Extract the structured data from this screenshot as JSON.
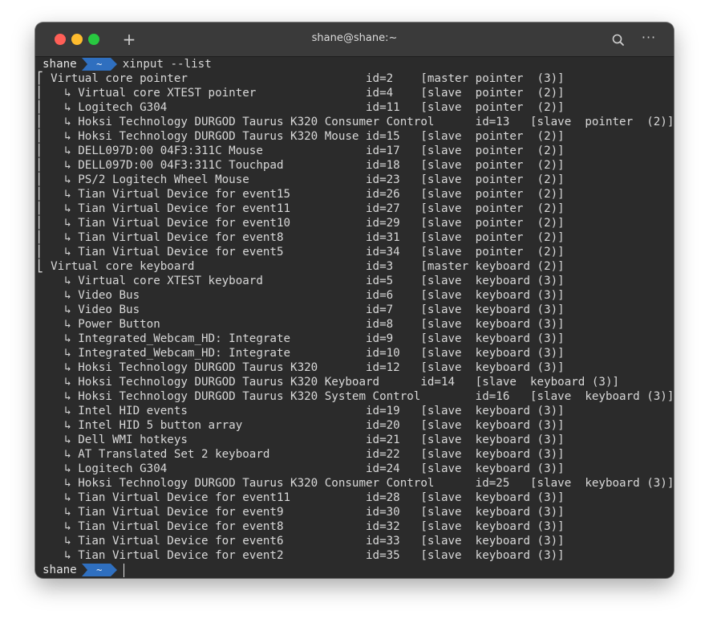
{
  "window": {
    "title": "shane@shane:~"
  },
  "prompt": {
    "user": "shane",
    "dir": "~",
    "command": "xinput --list"
  },
  "output": [
    "⎡ Virtual core pointer                    \tid=2\t[master pointer  (3)]",
    "⎜   ↳ Virtual core XTEST pointer              \tid=4\t[slave  pointer  (2)]",
    "⎜   ↳ Logitech G304                           \tid=11\t[slave  pointer  (2)]",
    "⎜   ↳ Hoksi Technology DURGOD Taurus K320 Consumer Control\tid=13\t[slave  pointer  (2)]",
    "⎜   ↳ Hoksi Technology DURGOD Taurus K320 Mouse\tid=15\t[slave  pointer  (2)]",
    "⎜   ↳ DELL097D:00 04F3:311C Mouse             \tid=17\t[slave  pointer  (2)]",
    "⎜   ↳ DELL097D:00 04F3:311C Touchpad          \tid=18\t[slave  pointer  (2)]",
    "⎜   ↳ PS/2 Logitech Wheel Mouse               \tid=23\t[slave  pointer  (2)]",
    "⎜   ↳ Tian Virtual Device for event15         \tid=26\t[slave  pointer  (2)]",
    "⎜   ↳ Tian Virtual Device for event11         \tid=27\t[slave  pointer  (2)]",
    "⎜   ↳ Tian Virtual Device for event10         \tid=29\t[slave  pointer  (2)]",
    "⎜   ↳ Tian Virtual Device for event8          \tid=31\t[slave  pointer  (2)]",
    "⎜   ↳ Tian Virtual Device for event5          \tid=34\t[slave  pointer  (2)]",
    "⎣ Virtual core keyboard                   \tid=3\t[master keyboard (2)]",
    "    ↳ Virtual core XTEST keyboard             \tid=5\t[slave  keyboard (3)]",
    "    ↳ Video Bus                               \tid=6\t[slave  keyboard (3)]",
    "    ↳ Video Bus                               \tid=7\t[slave  keyboard (3)]",
    "    ↳ Power Button                            \tid=8\t[slave  keyboard (3)]",
    "    ↳ Integrated_Webcam_HD: Integrate         \tid=9\t[slave  keyboard (3)]",
    "    ↳ Integrated_Webcam_HD: Integrate         \tid=10\t[slave  keyboard (3)]",
    "    ↳ Hoksi Technology DURGOD Taurus K320     \tid=12\t[slave  keyboard (3)]",
    "    ↳ Hoksi Technology DURGOD Taurus K320 Keyboard\tid=14\t[slave  keyboard (3)]",
    "    ↳ Hoksi Technology DURGOD Taurus K320 System Control\tid=16\t[slave  keyboard (3)]",
    "    ↳ Intel HID events                        \tid=19\t[slave  keyboard (3)]",
    "    ↳ Intel HID 5 button array                \tid=20\t[slave  keyboard (3)]",
    "    ↳ Dell WMI hotkeys                        \tid=21\t[slave  keyboard (3)]",
    "    ↳ AT Translated Set 2 keyboard            \tid=22\t[slave  keyboard (3)]",
    "    ↳ Logitech G304                           \tid=24\t[slave  keyboard (3)]",
    "    ↳ Hoksi Technology DURGOD Taurus K320 Consumer Control\tid=25\t[slave  keyboard (3)]",
    "    ↳ Tian Virtual Device for event11         \tid=28\t[slave  keyboard (3)]",
    "    ↳ Tian Virtual Device for event9          \tid=30\t[slave  keyboard (3)]",
    "    ↳ Tian Virtual Device for event8          \tid=32\t[slave  keyboard (3)]",
    "    ↳ Tian Virtual Device for event6          \tid=33\t[slave  keyboard (3)]",
    "    ↳ Tian Virtual Device for event2          \tid=35\t[slave  keyboard (3)]"
  ],
  "colors": {
    "chip": "#2f6fbf",
    "bracket": "#c9a227",
    "background": "#2b2b2b"
  },
  "icons": {
    "newtab": "plus-icon",
    "search": "search-icon",
    "menu": "more-horizontal-icon"
  }
}
